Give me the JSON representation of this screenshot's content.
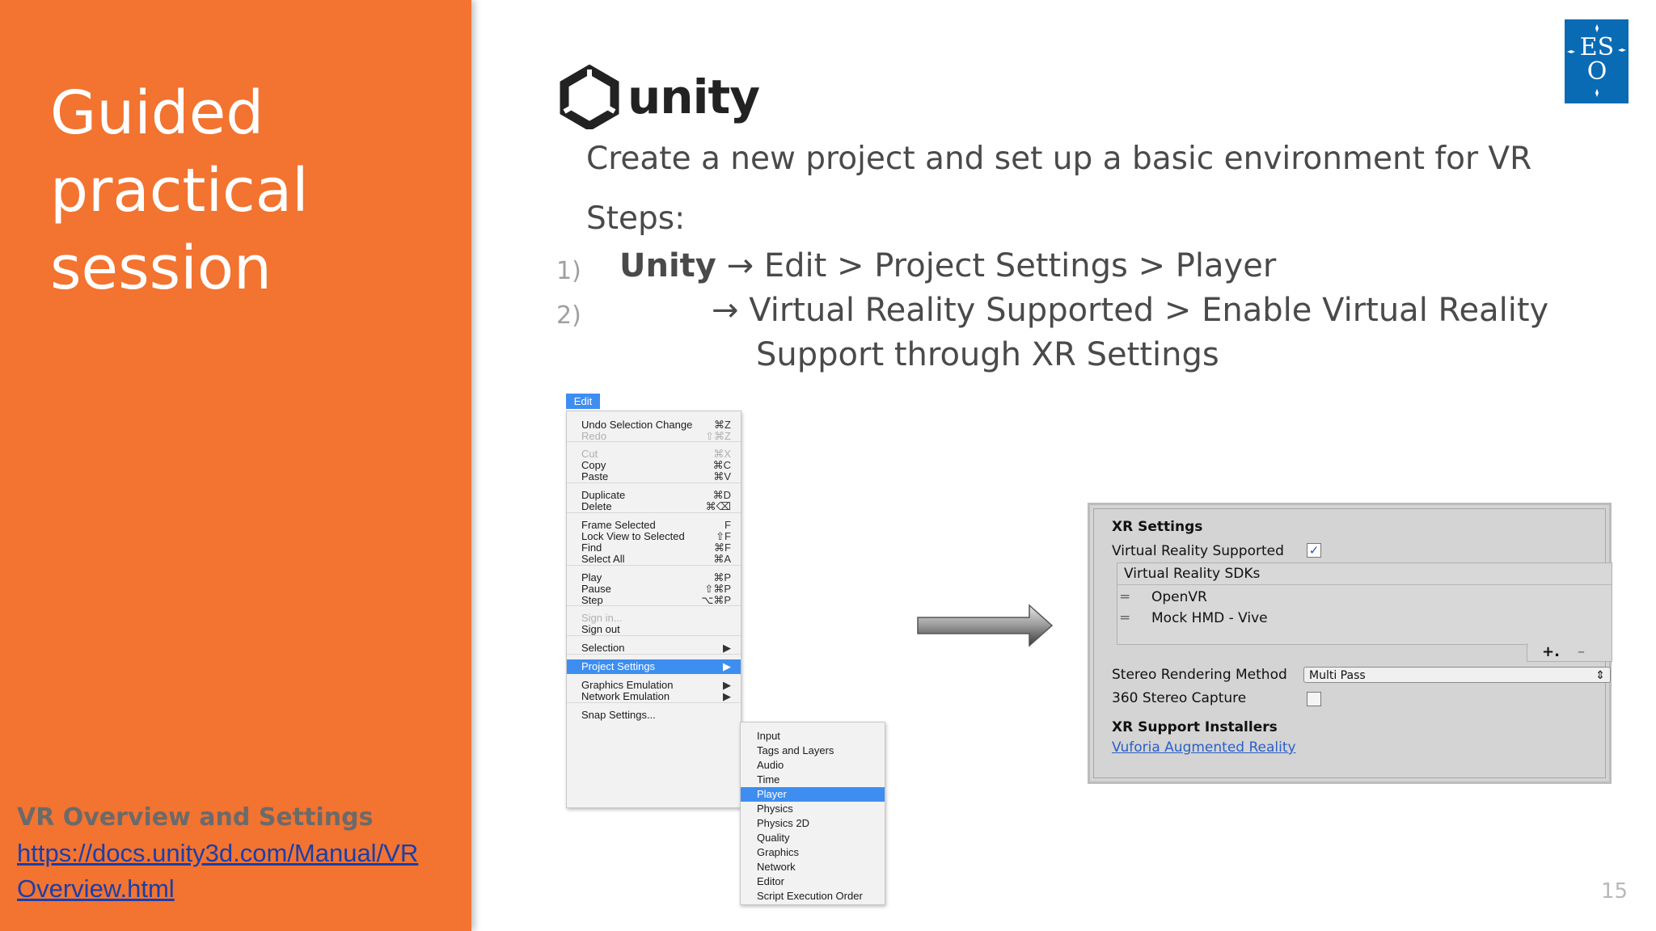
{
  "slide": {
    "title": "Guided\npractical\nsession",
    "reference_title": "VR Overview and Settings",
    "reference_link_line1": "https://docs.unity3d.com/Manual/VR",
    "reference_link_line2": "Overview.html",
    "subtitle": "Create a new project and set up a basic environment for VR",
    "steps_label": "Steps:",
    "step1_number": "1)",
    "step1_bold": "Unity",
    "step1_text": "→ Edit > Project Settings > Player",
    "step2_number": "2)",
    "step2_text": "→ Virtual Reality Supported > Enable Virtual Reality",
    "step2_text_cont": "Support through XR Settings",
    "page_number": "15"
  },
  "logos": {
    "unity_wordmark": "unity",
    "unity_icon": "unity-cube-icon",
    "eso_icon": "eso-logo-icon",
    "eso_color": "#0a6bb5"
  },
  "colors": {
    "accent_orange": "#f37330",
    "menu_highlight": "#3d8ef0",
    "link_blue": "#1a3fa8"
  },
  "edit_menu": {
    "tab_label": "Edit",
    "items": [
      {
        "label": "Undo Selection Change",
        "shortcut": "⌘Z"
      },
      {
        "label": "Redo",
        "shortcut": "⇧⌘Z"
      },
      {
        "label": "Cut",
        "shortcut": "⌘X"
      },
      {
        "label": "Copy",
        "shortcut": "⌘C"
      },
      {
        "label": "Paste",
        "shortcut": "⌘V"
      },
      {
        "label": "Duplicate",
        "shortcut": "⌘D"
      },
      {
        "label": "Delete",
        "shortcut": "⌘⌫"
      },
      {
        "label": "Frame Selected",
        "shortcut": "F"
      },
      {
        "label": "Lock View to Selected",
        "shortcut": "⇧F"
      },
      {
        "label": "Find",
        "shortcut": "⌘F"
      },
      {
        "label": "Select All",
        "shortcut": "⌘A"
      },
      {
        "label": "Play",
        "shortcut": "⌘P"
      },
      {
        "label": "Pause",
        "shortcut": "⇧⌘P"
      },
      {
        "label": "Step",
        "shortcut": "⌥⌘P"
      },
      {
        "label": "Sign in...",
        "shortcut": ""
      },
      {
        "label": "Sign out",
        "shortcut": ""
      },
      {
        "label": "Selection",
        "shortcut": "▶"
      },
      {
        "label": "Project Settings",
        "shortcut": "▶"
      },
      {
        "label": "Graphics Emulation",
        "shortcut": "▶"
      },
      {
        "label": "Network Emulation",
        "shortcut": "▶"
      },
      {
        "label": "Snap Settings...",
        "shortcut": ""
      }
    ]
  },
  "project_settings_submenu": {
    "items": [
      "Input",
      "Tags and Layers",
      "Audio",
      "Time",
      "Player",
      "Physics",
      "Physics 2D",
      "Quality",
      "Graphics",
      "Network",
      "Editor",
      "Script Execution Order"
    ]
  },
  "xr_settings": {
    "header": "XR Settings",
    "vr_supported_label": "Virtual Reality Supported",
    "vr_supported_check": "✓",
    "sdks_header": "Virtual Reality SDKs",
    "sdks": [
      "OpenVR",
      "Mock HMD - Vive"
    ],
    "drag_handle": "═",
    "add_symbol": "+.",
    "remove_symbol": "–",
    "stereo_label": "Stereo Rendering Method",
    "stereo_value": "Multi Pass",
    "stereo_arrows": "⇕",
    "capture_label": "360 Stereo Capture",
    "installers_header": "XR Support Installers",
    "installer_link": "Vuforia Augmented Reality"
  }
}
